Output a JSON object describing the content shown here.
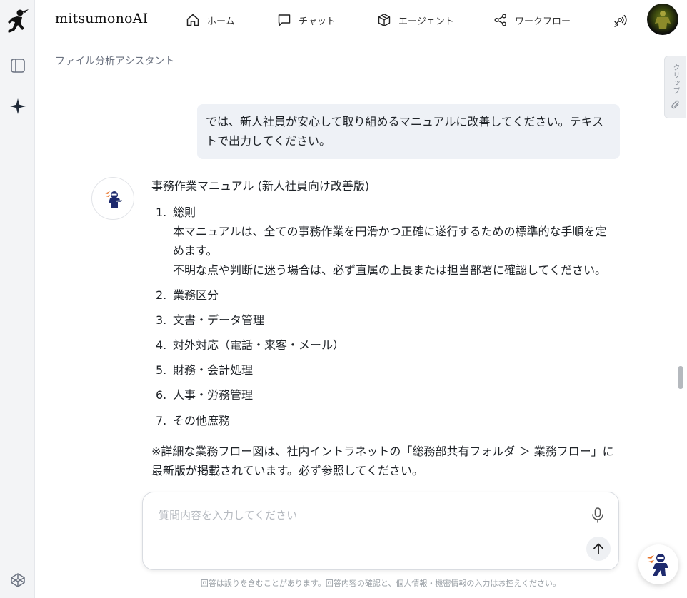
{
  "header": {
    "brand": "mitsumonoAI",
    "nav": [
      {
        "label": "ホーム",
        "icon": "home-icon"
      },
      {
        "label": "チャット",
        "icon": "chat-icon"
      },
      {
        "label": "エージェント",
        "icon": "cube-icon"
      },
      {
        "label": "ワークフロー",
        "icon": "share-icon"
      }
    ]
  },
  "breadcrumb": "ファイル分析アシスタント",
  "clip_tab": {
    "label": "クリップ"
  },
  "user_message": "では、新人社員が安心して取り組めるマニュアルに改善してください。テキストで出力してください。",
  "answer": {
    "title": "事務作業マニュアル (新人社員向け改善版)",
    "items": [
      {
        "num": "1.",
        "label": "総則",
        "lines": [
          "本マニュアルは、全ての事務作業を円滑かつ正確に遂行するための標準的な手順を定",
          "めます。",
          "不明な点や判断に迷う場合は、必ず直属の上長または担当部署に確認してください。"
        ]
      },
      {
        "num": "2.",
        "label": "業務区分"
      },
      {
        "num": "3.",
        "label": "文書・データ管理"
      },
      {
        "num": "4.",
        "label": "対外対応（電話・来客・メール）"
      },
      {
        "num": "5.",
        "label": "財務・会計処理"
      },
      {
        "num": "6.",
        "label": "人事・労務管理"
      },
      {
        "num": "7.",
        "label": "その他庶務"
      }
    ],
    "note_line1": "※詳細な業務フロー図は、社内イントラネットの「総務部共有フォルダ ＞ 業務フロー」に",
    "note_line2": "最新版が掲載されています。必ず参照してください。"
  },
  "composer": {
    "placeholder": "質問内容を入力してください"
  },
  "disclaimer": "回答は誤りを含むことがあります。回答内容の確認と、個人情報・機密情報の入力はお控えください。",
  "colors": {
    "accent_orange": "#e8742a",
    "navy": "#1e2a6e",
    "user_bubble": "#eef1f6"
  }
}
